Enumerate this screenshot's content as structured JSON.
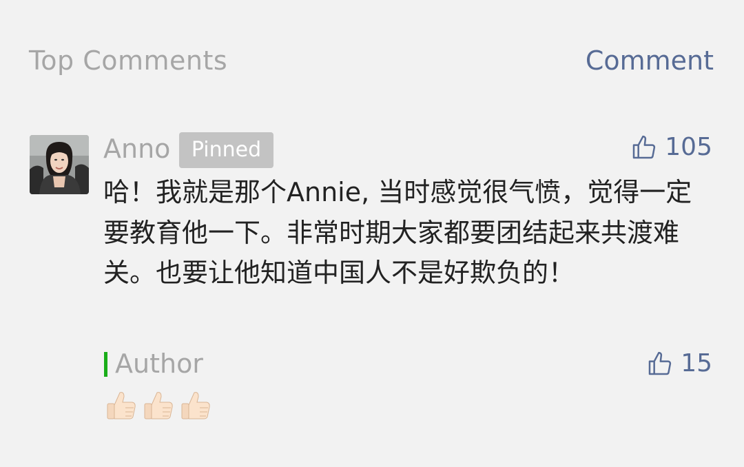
{
  "header": {
    "title": "Top Comments",
    "action_label": "Comment"
  },
  "comment": {
    "author": "Anno",
    "badge": "Pinned",
    "likes": "105",
    "text": "哈！我就是那个Annie, 当时感觉很气愤，觉得一定要教育他一下。非常时期大家都要团结起来共渡难关。也要让他知道中国人不是好欺负的！",
    "avatar_icon": "user-photo",
    "like_icon": "thumbs-up-outline-icon",
    "accent_color": "#576b95"
  },
  "reply": {
    "author": "Author",
    "likes": "15",
    "emojis": [
      "thumbs-up-emoji",
      "thumbs-up-emoji",
      "thumbs-up-emoji"
    ],
    "marker_color": "#1aad19"
  }
}
